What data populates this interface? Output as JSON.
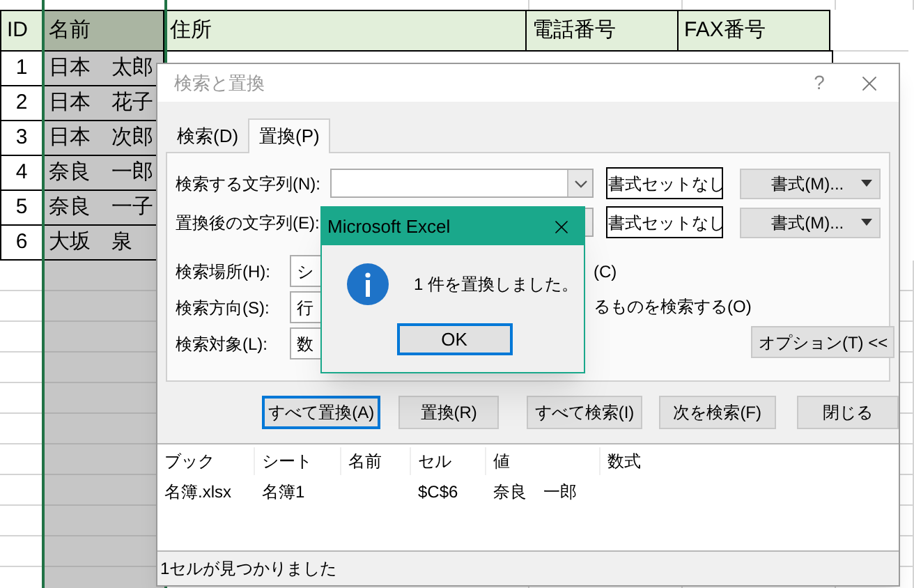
{
  "sheet": {
    "columns": [
      {
        "label": "ID",
        "selected": false
      },
      {
        "label": "名前",
        "selected": true
      },
      {
        "label": "住所",
        "selected": false
      },
      {
        "label": "電話番号",
        "selected": false
      },
      {
        "label": "FAX番号",
        "selected": false
      }
    ],
    "rows": [
      {
        "id": "1",
        "name": "日本　太郎"
      },
      {
        "id": "2",
        "name": "日本　花子"
      },
      {
        "id": "3",
        "name": "日本　次郎"
      },
      {
        "id": "4",
        "name": "奈良　一郎"
      },
      {
        "id": "5",
        "name": "奈良　一子"
      },
      {
        "id": "6",
        "name": "大坂　泉"
      }
    ]
  },
  "dialog": {
    "title": "検索と置換",
    "help": "?",
    "tabs": [
      {
        "label": "検索(D)",
        "selected": false
      },
      {
        "label": "置換(P)",
        "selected": true
      }
    ],
    "fields": [
      {
        "label": "検索する文字列(N):",
        "format_none": "書式セットなし",
        "format": "書式(M)..."
      },
      {
        "label": "置換後の文字列(E):",
        "format_none": "書式セットなし",
        "format": "書式(M)..."
      }
    ],
    "options": [
      {
        "label": "検索場所(H):",
        "value": "シ"
      },
      {
        "label": "検索方向(S):",
        "value": "行"
      },
      {
        "label": "検索対象(L):",
        "value": "数"
      }
    ],
    "checks": [
      "(C)",
      "るものを検索する(O)"
    ],
    "options_button": "オプション(T) <<",
    "buttons": [
      {
        "label": "すべて置換(A)",
        "focused": true
      },
      {
        "label": "置換(R)",
        "focused": false
      },
      {
        "label": "すべて検索(I)",
        "focused": false
      },
      {
        "label": "次を検索(F)",
        "focused": false
      },
      {
        "label": "閉じる",
        "focused": false
      }
    ],
    "results": {
      "columns": [
        "ブック",
        "シート",
        "名前",
        "セル",
        "値",
        "数式"
      ],
      "rows": [
        {
          "book": "名簿.xlsx",
          "sheet": "名簿1",
          "cell": "$C$6",
          "value": "奈良　一郎"
        }
      ]
    },
    "status": "1セルが見つかりました"
  },
  "message": {
    "title": "Microsoft Excel",
    "text": "1 件を置換しました。",
    "ok": "OK"
  }
}
